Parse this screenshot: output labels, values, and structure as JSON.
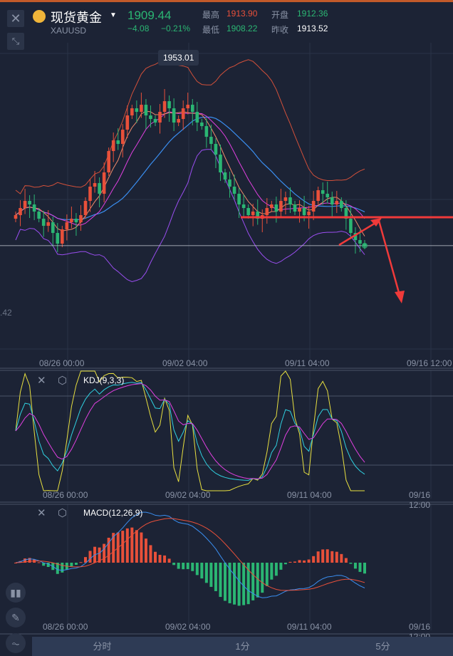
{
  "header": {
    "title": "现货黄金",
    "symbol": "XAUUSD",
    "price": "1909.44",
    "change": "−4.08",
    "change_pct": "−0.21%",
    "high_label": "最高",
    "high": "1913.90",
    "open_label": "开盘",
    "open": "1912.36",
    "low_label": "最低",
    "low": "1908.22",
    "prev_close_label": "昨收",
    "prev_close": "1913.52"
  },
  "tooltip": {
    "high_marker": "1953.01"
  },
  "price_axis_partial": ".42",
  "dates": [
    "08/26 00:00",
    "09/02 04:00",
    "09/11 04:00",
    "09/16 12:00"
  ],
  "kdj": {
    "title": "KDJ(9,3,3)"
  },
  "macd": {
    "title": "MACD(12,26,9)"
  },
  "tabs": [
    "分时",
    "1分",
    "5分"
  ],
  "colors": {
    "up": "#e8503a",
    "down": "#2bb673",
    "bg": "#1c2335",
    "annotation": "#f03a3a"
  },
  "chart_data": {
    "type": "candlestick",
    "price_range": [
      1905,
      1955
    ],
    "closes": [
      1918,
      1920,
      1922,
      1921,
      1919,
      1917,
      1915,
      1916,
      1913,
      1910,
      1914,
      1916,
      1917,
      1916,
      1918,
      1922,
      1926,
      1927,
      1924,
      1930,
      1936,
      1939,
      1938,
      1942,
      1946,
      1948,
      1947,
      1949,
      1946,
      1945,
      1944,
      1947,
      1950,
      1948,
      1944,
      1945,
      1948,
      1949,
      1947,
      1944,
      1943,
      1940,
      1938,
      1935,
      1930,
      1928,
      1926,
      1924,
      1921,
      1920,
      1918,
      1919,
      1917,
      1918,
      1920,
      1921,
      1919,
      1922,
      1923,
      1921,
      1919,
      1920,
      1918,
      1919,
      1922,
      1925,
      1924,
      1923,
      1921,
      1922,
      1920,
      1917,
      1913,
      1911,
      1910,
      1909.44
    ],
    "current_price": 1909.44,
    "support_line": 1917
  }
}
